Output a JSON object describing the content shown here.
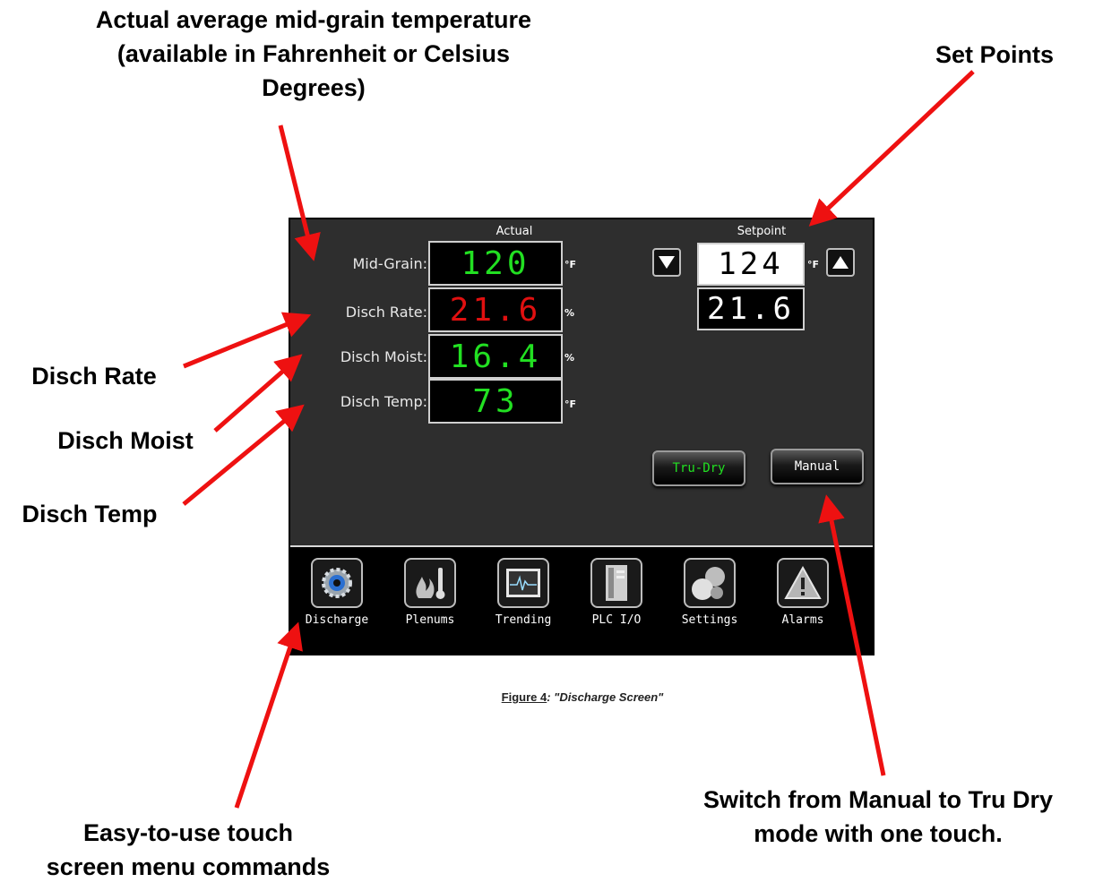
{
  "callouts": {
    "top_left": [
      "Actual average mid-grain temperature",
      "(available in Fahrenheit or Celsius",
      "Degrees)"
    ],
    "top_right": "Set Points",
    "disch_rate": "Disch Rate",
    "disch_moist": "Disch Moist",
    "disch_temp": "Disch Temp",
    "bottom_left": [
      "Easy-to-use touch",
      "screen menu commands"
    ],
    "bottom_right": [
      "Switch from Manual to Tru Dry",
      "mode with one touch."
    ]
  },
  "screen": {
    "actual_header": "Actual",
    "setpoint_header": "Setpoint",
    "rows": [
      {
        "label": "Mid-Grain:",
        "value": "120",
        "unit": "°F",
        "color": "#22e022"
      },
      {
        "label": "Disch Rate:",
        "value": "21.6",
        "unit": "%",
        "color": "#e01010"
      },
      {
        "label": "Disch Moist:",
        "value": "16.4",
        "unit": "%",
        "color": "#22e022"
      },
      {
        "label": "Disch Temp:",
        "value": "73",
        "unit": "°F",
        "color": "#22e022"
      }
    ],
    "setpoints": [
      {
        "value": "124",
        "unit": "°F"
      },
      {
        "value": "21.6"
      }
    ],
    "down_icon": "triangle-down-icon",
    "up_icon": "triangle-up-icon",
    "tru_dry_label": "Tru-Dry",
    "manual_label": "Manual",
    "tru_dry_color": "#22e022",
    "nav": [
      {
        "label": "Discharge",
        "icon": "gear-icon"
      },
      {
        "label": "Plenums",
        "icon": "flame-thermometer-icon"
      },
      {
        "label": "Trending",
        "icon": "trend-graph-icon"
      },
      {
        "label": "PLC I/O",
        "icon": "plc-cabinet-icon"
      },
      {
        "label": "Settings",
        "icon": "settings-spheres-icon"
      },
      {
        "label": "Alarms",
        "icon": "warning-icon"
      }
    ]
  },
  "caption": {
    "prefix": "Figure 4",
    "text": ": \"Discharge Screen\""
  },
  "colors": {
    "arrow": "#ee1111",
    "screen_bg": "#2e2e2e"
  }
}
